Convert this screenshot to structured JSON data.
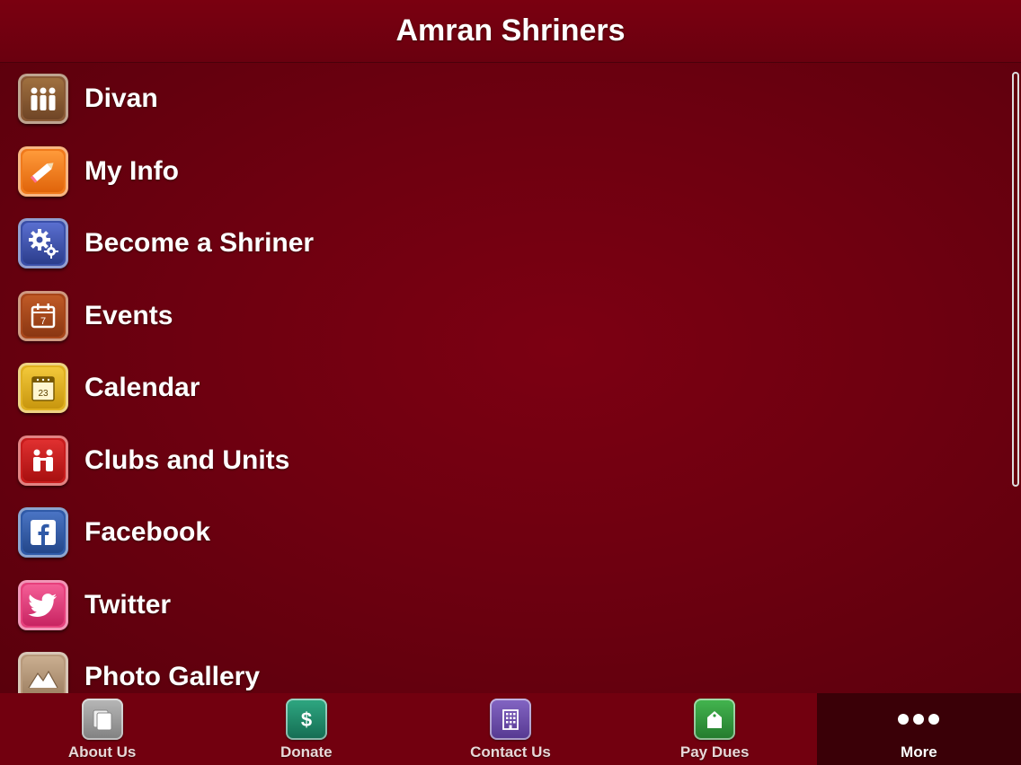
{
  "header": {
    "title": "Amran Shriners"
  },
  "menu": {
    "items": [
      {
        "label": "Divan",
        "icon": "people-icon",
        "color": "#8a5a36"
      },
      {
        "label": "My Info",
        "icon": "pencil-icon",
        "color": "#f07a1c"
      },
      {
        "label": "Become a Shriner",
        "icon": "gears-icon",
        "color": "#3a4fa8"
      },
      {
        "label": "Events",
        "icon": "calendar-page-icon",
        "color": "#a8461a"
      },
      {
        "label": "Calendar",
        "icon": "calendar-grid-icon",
        "color": "#e0b020"
      },
      {
        "label": "Clubs and Units",
        "icon": "group-icon",
        "color": "#c81c1c"
      },
      {
        "label": "Facebook",
        "icon": "facebook-icon",
        "color": "#2f5aa8"
      },
      {
        "label": "Twitter",
        "icon": "twitter-icon",
        "color": "#e6407c"
      },
      {
        "label": "Photo Gallery",
        "icon": "mountains-icon",
        "color": "#b89a7c"
      }
    ]
  },
  "tabbar": {
    "tabs": [
      {
        "label": "About Us",
        "icon": "pages-icon",
        "color": "#9a9a9a"
      },
      {
        "label": "Donate",
        "icon": "dollar-icon",
        "color": "#1f8a6a"
      },
      {
        "label": "Contact Us",
        "icon": "building-icon",
        "color": "#6a4aa8"
      },
      {
        "label": "Pay Dues",
        "icon": "tag-icon",
        "color": "#2e9a3a"
      },
      {
        "label": "More",
        "icon": "more-dots-icon",
        "active": true
      }
    ]
  },
  "colors": {
    "background": "#6e0010",
    "tabbar_active": "#3a0007"
  }
}
